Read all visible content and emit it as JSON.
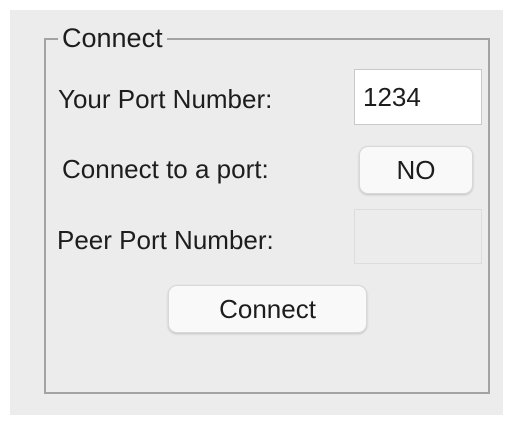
{
  "group": {
    "title": "Connect"
  },
  "your_port": {
    "label": "Your Port Number:",
    "value": "1234"
  },
  "connect_to_port": {
    "label": "Connect to a port:",
    "toggle_label": "NO"
  },
  "peer_port": {
    "label": "Peer Port Number:",
    "value": ""
  },
  "connect_button": {
    "label": "Connect"
  }
}
